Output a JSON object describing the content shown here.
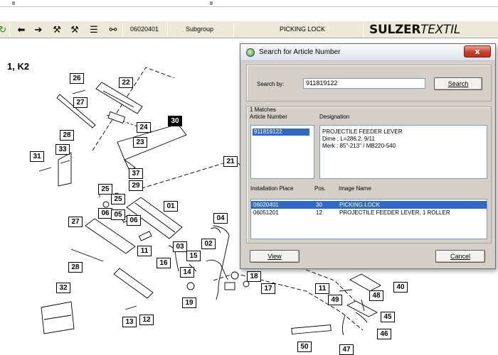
{
  "toolbar": {
    "article": "06020401",
    "subgroup_label": "Subgroup",
    "subgroup_name": "PICKING LOCK",
    "brand_bold": "SULZER",
    "brand_italic": "TEXTIL",
    "icons": [
      "refresh-icon",
      "arrow-left-icon",
      "arrow-right-icon",
      "tool-icon",
      "tool-alt-icon",
      "document-icon",
      "binoculars-icon"
    ]
  },
  "drawing": {
    "sheet_label": "1, K2",
    "callouts": [
      "26",
      "22",
      "27",
      "28",
      "30",
      "24",
      "23",
      "33",
      "31",
      "37",
      "29",
      "25",
      "25",
      "06",
      "05",
      "01",
      "06",
      "04",
      "27",
      "11",
      "03",
      "02",
      "15",
      "16",
      "14",
      "28",
      "19",
      "32",
      "13",
      "12",
      "18",
      "17",
      "21",
      "11",
      "49",
      "48",
      "40",
      "45",
      "46",
      "47",
      "50"
    ]
  },
  "dialog": {
    "title": "Search for Article Number",
    "close_label": "x",
    "search_by_label": "Search by:",
    "search_value": "911819122",
    "search_button": "Search",
    "matches_label": "1 Matches",
    "article_number_header": "Article Number",
    "designation_header": "Designation",
    "article_numbers": [
      "911819122"
    ],
    "designation_lines": [
      "PROJECTILE FEEDER LEVER",
      "Dime : L=286.2, 9/11",
      "Merk : 85\"-213\" / MB220-540"
    ],
    "installation_place_header": "Installation Place",
    "pos_header": "Pos.",
    "image_name_header": "Image Name",
    "installations": [
      {
        "place": "06020401",
        "pos": "30",
        "image": "PICKING LOCK"
      },
      {
        "place": "06051201",
        "pos": "12",
        "image": "PROJECTILE FEEDER LEVER, 1 ROLLER"
      }
    ],
    "view_button": "View",
    "cancel_button": "Cancel"
  }
}
